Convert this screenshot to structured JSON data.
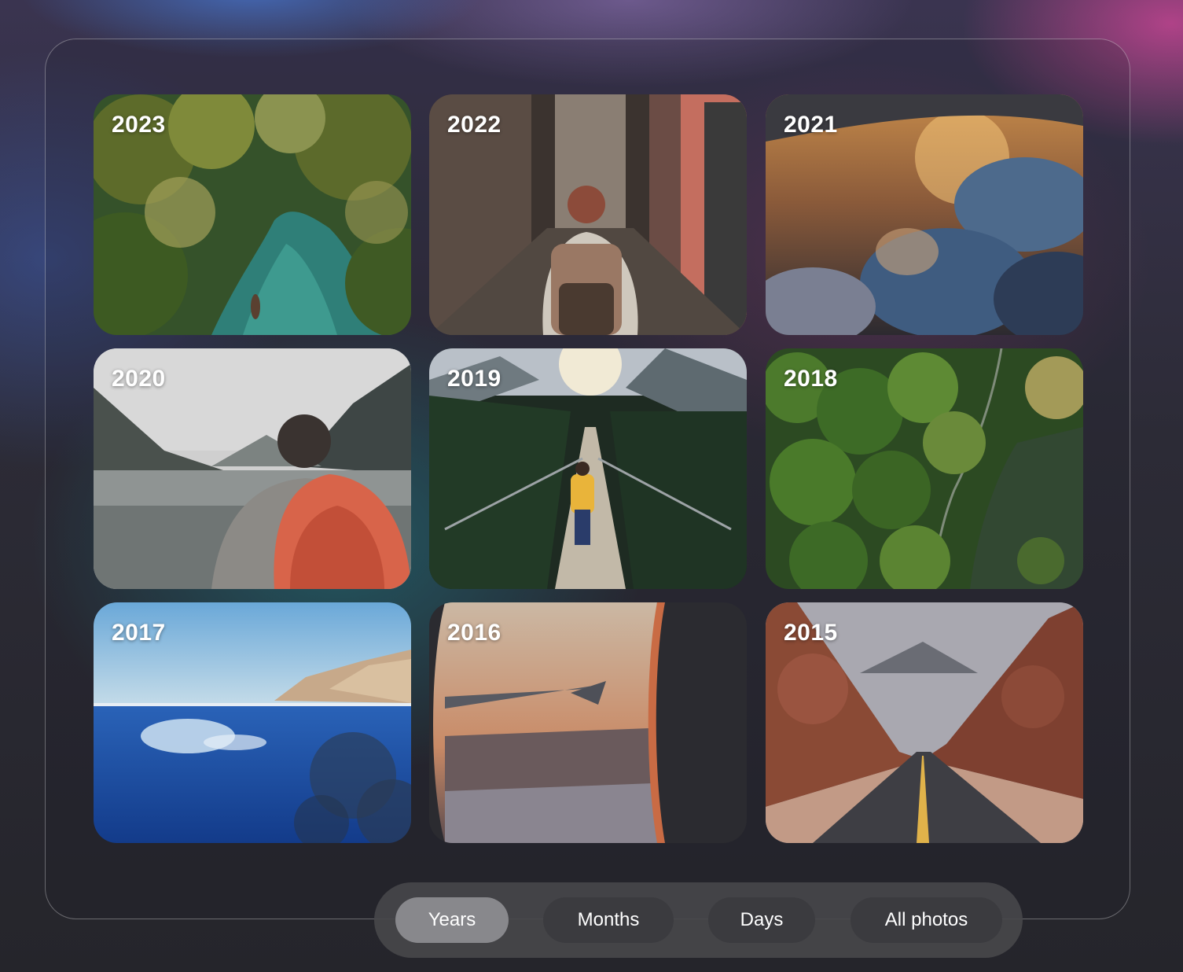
{
  "gallery": {
    "tiles": [
      {
        "label": "2023"
      },
      {
        "label": "2022"
      },
      {
        "label": "2021"
      },
      {
        "label": "2020"
      },
      {
        "label": "2019"
      },
      {
        "label": "2018"
      },
      {
        "label": "2017"
      },
      {
        "label": "2016"
      },
      {
        "label": "2015"
      }
    ]
  },
  "view_switcher": {
    "options": [
      {
        "label": "Years",
        "selected": true
      },
      {
        "label": "Months",
        "selected": false
      },
      {
        "label": "Days",
        "selected": false
      },
      {
        "label": "All photos",
        "selected": false
      }
    ]
  }
}
